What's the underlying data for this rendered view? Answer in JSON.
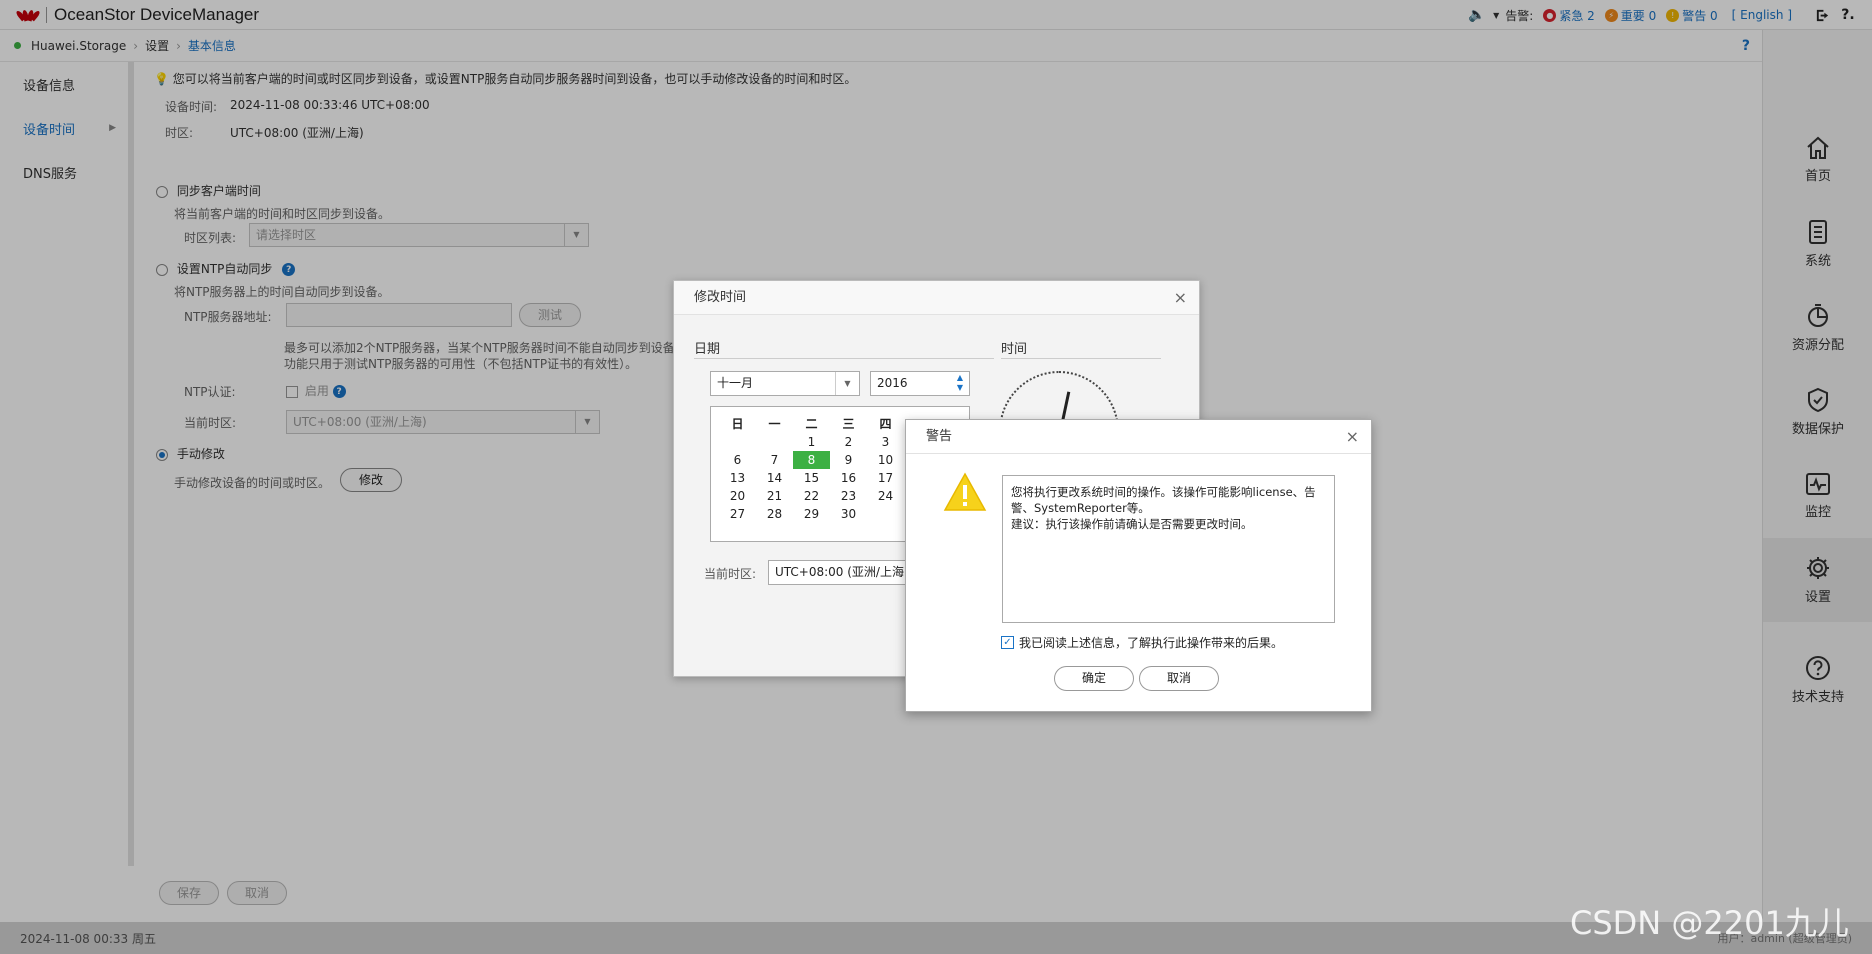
{
  "app": {
    "title": "OceanStor DeviceManager",
    "alarm_label": "告警:",
    "alarms": {
      "critical": "紧急 2",
      "major": "重要 0",
      "warning": "警告 0"
    },
    "language": "[ English ]",
    "colors": {
      "critical": "#d9232e",
      "major": "#f08a1c",
      "warning": "#f2b705",
      "accent": "#1a73c6"
    }
  },
  "breadcrumb": {
    "root": "Huawei.Storage",
    "level1": "设置",
    "current": "基本信息",
    "help": "?"
  },
  "leftnav": {
    "items": [
      {
        "label": "设备信息"
      },
      {
        "label": "设备时间"
      },
      {
        "label": "DNS服务"
      }
    ]
  },
  "main": {
    "tip": "您可以将当前客户端的时间或时区同步到设备，或设置NTP服务自动同步服务器时间到设备，也可以手动修改设备的时间和时区。",
    "device_time_label": "设备时间:",
    "device_time_value": "2024-11-08 00:33:46 UTC+08:00",
    "tz_label": "时区:",
    "tz_value": "UTC+08:00 (亚洲/上海)",
    "sync_client": {
      "title": "同步客户端时间",
      "desc": "将当前客户端的时间和时区同步到设备。",
      "tz_list_label": "时区列表:",
      "tz_list_placeholder": "请选择时区"
    },
    "ntp": {
      "title": "设置NTP自动同步",
      "desc": "将NTP服务器上的时间自动同步到设备。",
      "server_label": "NTP服务器地址:",
      "test_button": "测试",
      "note1": "最多可以添加2个NTP服务器，当某个NTP服务器时间不能自动同步到设备",
      "note2": "功能只用于测试NTP服务器的可用性（不包括NTP证书的有效性）。",
      "auth_label": "NTP认证:",
      "enable_label": "启用",
      "current_tz_label": "当前时区:",
      "current_tz_value": "UTC+08:00 (亚洲/上海)"
    },
    "manual": {
      "title": "手动修改",
      "desc": "手动修改设备的时间或时区。",
      "modify_button": "修改"
    },
    "save_button": "保存",
    "cancel_button": "取消"
  },
  "rightnav": {
    "items": [
      {
        "label": "首页",
        "icon": "home-icon"
      },
      {
        "label": "系统",
        "icon": "system-icon"
      },
      {
        "label": "资源分配",
        "icon": "resource-icon"
      },
      {
        "label": "数据保护",
        "icon": "shield-icon"
      },
      {
        "label": "监控",
        "icon": "monitor-icon"
      },
      {
        "label": "设置",
        "icon": "gear-icon"
      },
      {
        "label": "技术支持",
        "icon": "help-icon"
      }
    ]
  },
  "statusbar": {
    "datetime": "2024-11-08 00:33 周五",
    "user": "用户：admin (超级管理员)"
  },
  "time_dialog": {
    "title": "修改时间",
    "date_header": "日期",
    "time_header": "时间",
    "month": "十一月",
    "year": "2016",
    "weekdays": [
      "日",
      "一",
      "二",
      "三",
      "四"
    ],
    "days": [
      "",
      "",
      "1",
      "2",
      "3",
      "6",
      "7",
      "8",
      "9",
      "10",
      "13",
      "14",
      "15",
      "16",
      "17",
      "20",
      "21",
      "22",
      "23",
      "24",
      "27",
      "28",
      "29",
      "30",
      ""
    ],
    "selected_day": "8",
    "current_tz_label": "当前时区:",
    "current_tz_value": "UTC+08:00 (亚洲/上海)"
  },
  "warn_dialog": {
    "title": "警告",
    "message1": "您将执行更改系统时间的操作。该操作可能影响license、告警、SystemReporter等。",
    "message2": "建议：执行该操作前请确认是否需要更改时间。",
    "ack": "我已阅读上述信息，了解执行此操作带来的后果。",
    "ok": "确定",
    "cancel": "取消"
  },
  "watermark": "CSDN @2201九儿"
}
